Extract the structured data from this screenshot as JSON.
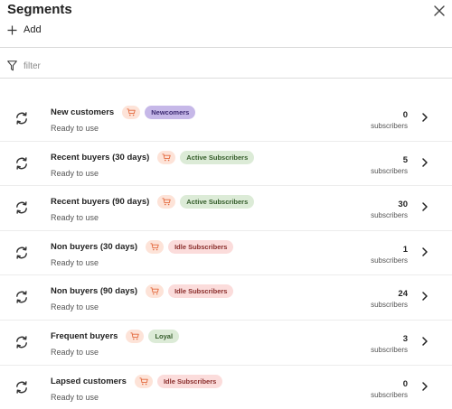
{
  "header": {
    "title": "Segments",
    "add_label": "Add",
    "close_icon": "close-icon"
  },
  "filter": {
    "placeholder": "filter",
    "value": ""
  },
  "colors": {
    "cart_badge_bg": "#fde3d8",
    "cart_icon": "#e3693d",
    "tags": {
      "Newcomers": {
        "bg": "#c6b8e8",
        "fg": "#3d2b73"
      },
      "Active Subscribers": {
        "bg": "#dcebd7",
        "fg": "#345c2a"
      },
      "Idle Subscribers": {
        "bg": "#fbdcdb",
        "fg": "#8a2e2c"
      },
      "Loyal": {
        "bg": "#dcebd7",
        "fg": "#345c2a"
      }
    }
  },
  "segments": [
    {
      "name": "New customers",
      "tag": "Newcomers",
      "status": "Ready to use",
      "count": "0",
      "count_label": "subscribers"
    },
    {
      "name": "Recent buyers (30 days)",
      "tag": "Active Subscribers",
      "status": "Ready to use",
      "count": "5",
      "count_label": "subscribers"
    },
    {
      "name": "Recent buyers (90 days)",
      "tag": "Active Subscribers",
      "status": "Ready to use",
      "count": "30",
      "count_label": "subscribers"
    },
    {
      "name": "Non buyers (30 days)",
      "tag": "Idle Subscribers",
      "status": "Ready to use",
      "count": "1",
      "count_label": "subscribers"
    },
    {
      "name": "Non buyers (90 days)",
      "tag": "Idle Subscribers",
      "status": "Ready to use",
      "count": "24",
      "count_label": "subscribers"
    },
    {
      "name": "Frequent buyers",
      "tag": "Loyal",
      "status": "Ready to use",
      "count": "3",
      "count_label": "subscribers"
    },
    {
      "name": "Lapsed customers",
      "tag": "Idle Subscribers",
      "status": "Ready to use",
      "count": "0",
      "count_label": "subscribers"
    }
  ]
}
